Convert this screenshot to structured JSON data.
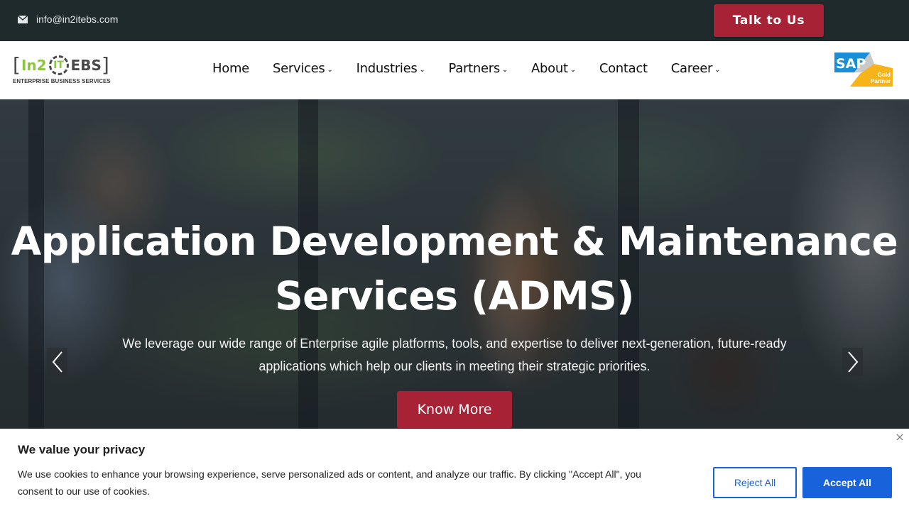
{
  "topbar": {
    "email_icon": "envelope-icon",
    "email": "info@in2itebs.com",
    "cta_label": "Talk to Us",
    "cta_color": "#a82236",
    "background": "#1f2a2c"
  },
  "logo": {
    "bracket_open": "[",
    "part1": "In2",
    "part2": "IT",
    "part3": "EBS",
    "bracket_close": "]",
    "tagline": "ENTERPRISE BUSINESS SERVICES",
    "accent": "#8cc63f"
  },
  "nav": {
    "items": [
      {
        "label": "Home",
        "has_dropdown": false
      },
      {
        "label": "Services",
        "has_dropdown": true
      },
      {
        "label": "Industries",
        "has_dropdown": true
      },
      {
        "label": "Partners",
        "has_dropdown": true
      },
      {
        "label": "About",
        "has_dropdown": true
      },
      {
        "label": "Contact",
        "has_dropdown": false
      },
      {
        "label": "Career",
        "has_dropdown": true
      }
    ],
    "dropdown_glyph": "⌄"
  },
  "partner_badge": {
    "brand": "SAP",
    "line1": "Gold",
    "line2": "Partner"
  },
  "hero": {
    "title": "Application Development & Maintenance Services (ADMS)",
    "subtitle": "We leverage our wide range of Enterprise agile platforms, tools, and expertise to deliver next-generation, future-ready applications which help our clients in meeting their strategic priorities.",
    "cta_label": "Know More",
    "prev_icon": "chevron-left-icon",
    "next_icon": "chevron-right-icon"
  },
  "cookie_banner": {
    "title": "We value your privacy",
    "text": "We use cookies to enhance your browsing experience, serve personalized ads or content, and analyze our traffic. By clicking \"Accept All\", you consent to our use of cookies.",
    "reject_label": "Reject All",
    "accept_label": "Accept All",
    "accent": "#1863dc",
    "close_icon": "close-icon"
  }
}
